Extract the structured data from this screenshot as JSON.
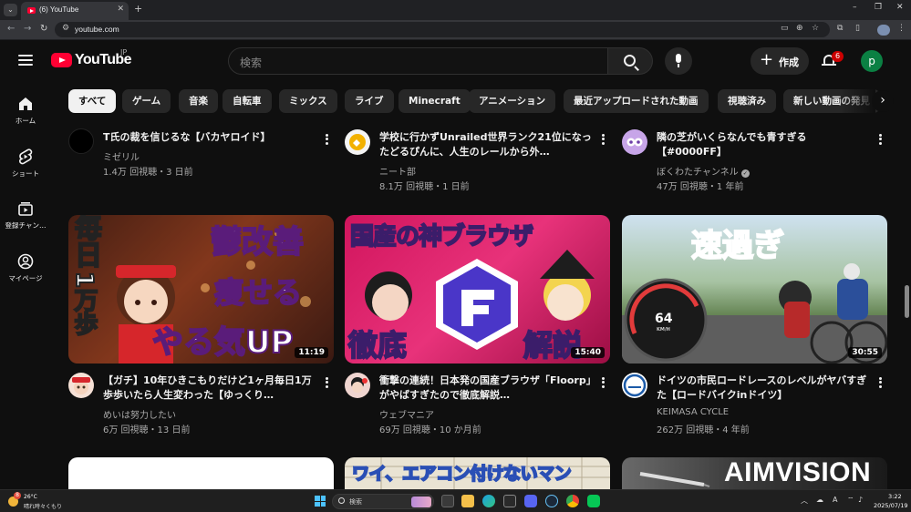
{
  "browser": {
    "tab_title": "(6) YouTube",
    "url": "youtube.com",
    "window_minimize": "–",
    "window_maximize": "❐",
    "window_close": "✕",
    "new_tab": "+",
    "tab_close": "✕",
    "tab_menu": "⌄"
  },
  "header": {
    "logo_text": "YouTube",
    "country_code": "JP",
    "search_placeholder": "検索",
    "create_label": "作成",
    "notification_count": "6",
    "avatar_letter": "p"
  },
  "guide": [
    {
      "label": "ホーム",
      "icon": "home-icon"
    },
    {
      "label": "ショート",
      "icon": "shorts-icon"
    },
    {
      "label": "登録チャン…",
      "icon": "subscriptions-icon"
    },
    {
      "label": "マイページ",
      "icon": "you-icon"
    }
  ],
  "chips": [
    "すべて",
    "ゲーム",
    "音楽",
    "自転車",
    "ミックス",
    "ライブ",
    "Minecraft",
    "アニメーション",
    "最近アップロードされた動画",
    "視聴済み",
    "新しい動画の発見"
  ],
  "chips_active": 0,
  "videos_top": [
    {
      "title": "T氏の裁を信じるな【バカヤロイド】",
      "channel": "ミゼリル",
      "meta": "1.4万 回視聴・3 日前"
    },
    {
      "title": "学校に行かずUnrailed世界ランク21位になったどるぴんに、人生のレールから外…",
      "channel": "ニート部",
      "meta": "8.1万 回視聴・1 日前"
    },
    {
      "title": "隣の芝がいくらなんでも青すぎる【#0000FF】",
      "channel": "ぼくわたチャンネル",
      "meta": "47万 回視聴・1 年前",
      "verified": true
    }
  ],
  "videos_mid": [
    {
      "title": "【ガチ】10年ひきこもりだけど1ヶ月毎日1万歩歩いたら人生変わった【ゆっくり…",
      "channel": "めいは努力したい",
      "meta": "6万 回視聴・13 日前",
      "duration": "11:19",
      "thumb_lines": [
        "毎日",
        "1万歩",
        "鬱改善",
        "痩せる",
        "やる気UP"
      ]
    },
    {
      "title": "衝撃の連続！日本発の国産ブラウザ「Floorp」がやばすぎたので徹底解説…",
      "channel": "ウェブマニア",
      "meta": "69万 回視聴・10 か月前",
      "duration": "15:40",
      "thumb_lines": [
        "国産の神ブラウザ",
        "徹底",
        "解説"
      ]
    },
    {
      "title": "ドイツの市民ロードレースのレベルがヤバすぎた【ロードバイクinドイツ】",
      "channel": "KEIMASA CYCLE",
      "meta": "262万 回視聴・4 年前",
      "duration": "30:55",
      "thumb_lines": [
        "速過ぎ",
        "64",
        "KM/H"
      ]
    }
  ],
  "videos_bottom": [
    {
      "thumb_lines": []
    },
    {
      "thumb_lines": [
        "ワイ、エアコン付けないマン"
      ]
    },
    {
      "thumb_lines": [
        "AIMVISION"
      ]
    }
  ],
  "taskbar": {
    "weather_badge": "8",
    "weather_temp": "26°C",
    "weather_cond": "晴れ時々くもり",
    "search_text": "検索",
    "ime": "A",
    "time": "3:22",
    "date": "2025/07/19"
  },
  "colors": {
    "yt_red": "#ff0033",
    "bg": "#0f0f0f",
    "chip": "#272727",
    "avatar": "#0b8043",
    "taskbar": "#1f1f1f"
  }
}
